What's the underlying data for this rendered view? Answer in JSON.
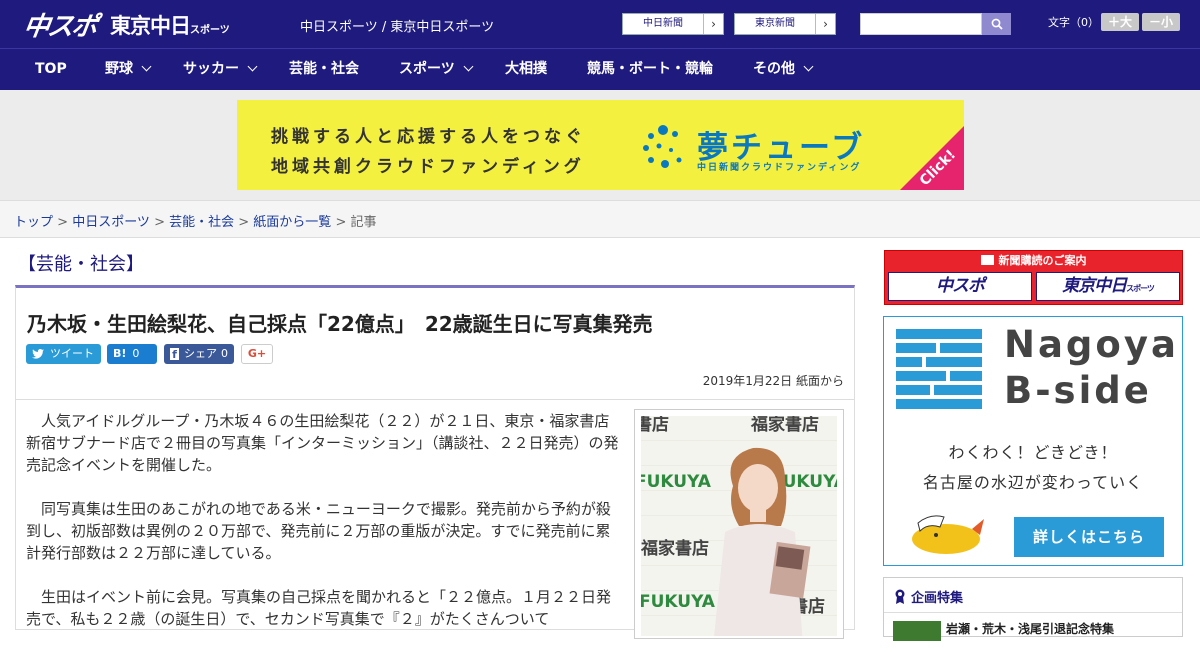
{
  "header": {
    "logo_main": "中スポ",
    "logo_tokyo": "東京中日",
    "logo_tokyo_small": "スポーツ",
    "site_title": "中日スポーツ / 東京中日スポーツ",
    "ext_links": [
      {
        "label": "中日新聞"
      },
      {
        "label": "東京新聞"
      }
    ],
    "search_placeholder": "",
    "text_size_label": "文字（0）",
    "size_up_label": "＋大",
    "size_down_label": "－小",
    "colors": {
      "bar": "#1f1a7e"
    }
  },
  "nav": {
    "items": [
      {
        "label": "TOP",
        "has_menu": false
      },
      {
        "label": "野球",
        "has_menu": true
      },
      {
        "label": "サッカー",
        "has_menu": true
      },
      {
        "label": "芸能・社会",
        "has_menu": false
      },
      {
        "label": "スポーツ",
        "has_menu": true
      },
      {
        "label": "大相撲",
        "has_menu": false
      },
      {
        "label": "競馬・ボート・競輪",
        "has_menu": false
      },
      {
        "label": "その他",
        "has_menu": true
      }
    ]
  },
  "banner": {
    "line1": "挑戦する人と応援する人をつなぐ",
    "line2": "地域共創クラウドファンディング",
    "brand": "夢チューブ",
    "brand_sub": "中日新聞クラウドファンディング",
    "click_label": "Click!"
  },
  "breadcrumb": {
    "items": [
      "トップ",
      "中日スポーツ",
      "芸能・社会",
      "紙面から一覧"
    ],
    "current": "記事",
    "separator": " > "
  },
  "category": "【芸能・社会】",
  "article": {
    "headline": "乃木坂・生田絵梨花、自己採点「22億点」　22歳誕生日に写真集発売",
    "share": {
      "twitter_label": "ツイート",
      "hatena_label": "B!",
      "hatena_count": "0",
      "facebook_label": "シェア",
      "facebook_count": "0",
      "gplus_label": "G+"
    },
    "date": "2019年1月22日 紙面から",
    "paragraphs": [
      "人気アイドルグループ・乃木坂４６の生田絵梨花（２２）が２１日、東京・福家書店新宿サブナード店で２冊目の写真集「インターミッション」（講談社、２２日発売）の発売記念イベントを開催した。",
      "同写真集は生田のあこがれの地である米・ニューヨークで撮影。発売前から予約が殺到し、初版部数は異例の２０万部で、発売前に２万部の重版が決定。すでに発売前に累計発行部数は２２万部に達している。",
      "生田はイベント前に会見。写真集の自己採点を聞かれると「２２億点。１月２２日発売で、私も２２歳（の誕生日）で、セカンド写真集で『２』がたくさんついて"
    ],
    "photo_sign_text": [
      "福家書店",
      "福家書店",
      "FUKUYA",
      "FUKUYA",
      "福家書店",
      "FUKUYA",
      "書店"
    ]
  },
  "sidebar": {
    "subscribe_title": "新聞購読のご案内",
    "subscribe_logo_main": "中スポ",
    "subscribe_logo_tokyo": "東京中日",
    "subscribe_logo_tokyo_small": "スポーツ",
    "bside": {
      "title_line1": "Nagoya",
      "title_line2": "B-side",
      "copy_line1": "わくわく！どきどき！",
      "copy_line2": "名古屋の水辺が変わっていく",
      "button_label": "詳しくはこちら"
    },
    "feature": {
      "title": "企画特集",
      "first_item": "岩瀬・荒木・浅尾引退記念特集"
    }
  }
}
